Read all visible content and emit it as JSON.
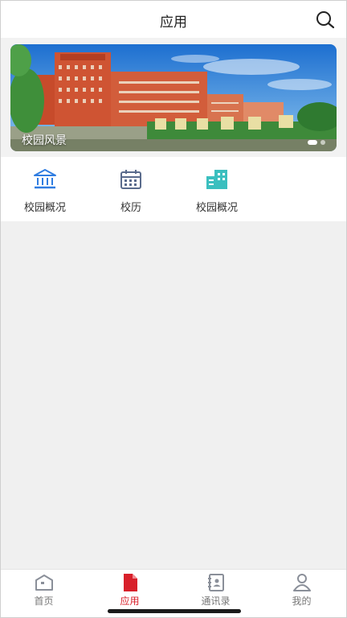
{
  "header": {
    "title": "应用",
    "search_icon": "search-icon"
  },
  "banner": {
    "caption": "校园风景",
    "slide_count": 2,
    "active_slide": 1
  },
  "apps": [
    {
      "label": "校园概况",
      "icon": "bank-icon",
      "color": "#2f7de1"
    },
    {
      "label": "校历",
      "icon": "calendar-icon",
      "color": "#5a6b8c"
    },
    {
      "label": "校园概况",
      "icon": "building-icon",
      "color": "#3bbfbf"
    }
  ],
  "tabbar": {
    "items": [
      {
        "label": "首页",
        "icon": "home-icon",
        "active": false
      },
      {
        "label": "应用",
        "icon": "document-icon",
        "active": true
      },
      {
        "label": "通讯录",
        "icon": "contacts-icon",
        "active": false
      },
      {
        "label": "我的",
        "icon": "person-icon",
        "active": false
      }
    ],
    "active_color": "#d8202a",
    "inactive_color": "#777777"
  }
}
